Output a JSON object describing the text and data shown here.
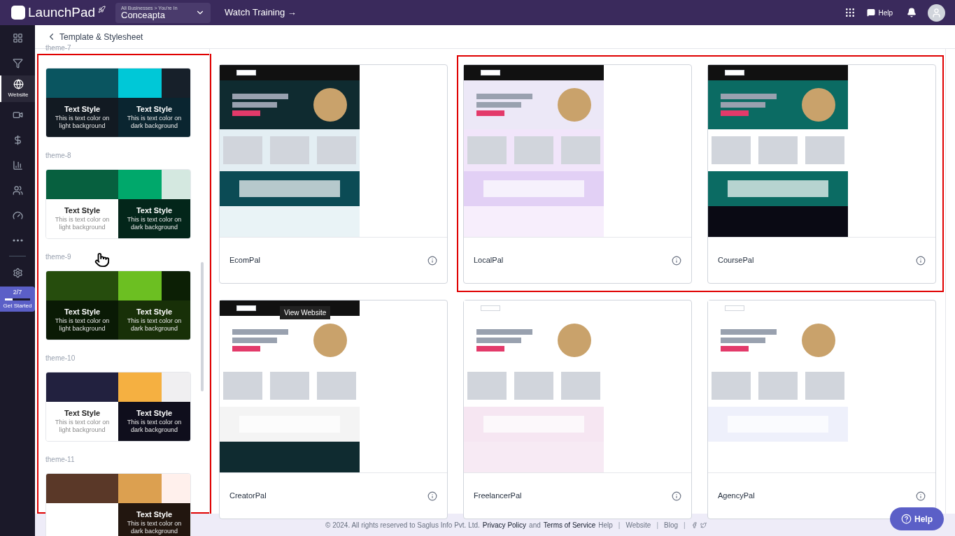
{
  "topbar": {
    "brand": "LaunchPad",
    "business": {
      "caption": "All Businesses > You're In",
      "value": "Conceapta"
    },
    "training": "Watch Training →",
    "help": "Help"
  },
  "sidebar": {
    "items": [
      {
        "selected": false
      },
      {
        "selected": false
      },
      {
        "selected": true,
        "label": "Website"
      },
      {
        "selected": false
      },
      {
        "selected": false
      },
      {
        "selected": false
      },
      {
        "selected": false
      },
      {
        "selected": false
      },
      {
        "selected": false
      }
    ],
    "progress": {
      "count": "2/7",
      "level": 0.3,
      "label": "Get Started"
    }
  },
  "page": {
    "title": "Template & Stylesheet"
  },
  "themes": [
    {
      "name": "theme-7",
      "swatches": [
        {
          "color": "#0a5560"
        },
        {
          "color": "#00c8d7"
        },
        {
          "color": "#17202a"
        }
      ],
      "light": {
        "color": "#121a22",
        "title": "Text Style",
        "text": "This is text color on light background"
      },
      "dark": {
        "color": "#0a2530",
        "title": "Text Style",
        "text": "This is text color on dark background"
      }
    },
    {
      "name": "theme-8",
      "swatches": [
        {
          "color": "#07603f"
        },
        {
          "color": "#00a86b"
        },
        {
          "color": "#d4e8e0"
        }
      ],
      "light": {
        "color": "#ffffff",
        "title": "Text Style",
        "text": "This is text color on light background"
      },
      "dark": {
        "color": "#03261a",
        "title": "Text Style",
        "text": "This is text color on dark background"
      }
    },
    {
      "name": "theme-9",
      "swatches": [
        {
          "color": "#264d0d"
        },
        {
          "color": "#6cbf22"
        },
        {
          "color": "#0c1f05"
        }
      ],
      "light": {
        "color": "#0a1a05",
        "title": "Text Style",
        "text": "This is text color on light background"
      },
      "dark": {
        "color": "#183008",
        "title": "Text Style",
        "text": "This is text color on dark background"
      }
    },
    {
      "name": "theme-10",
      "swatches": [
        {
          "color": "#22213f"
        },
        {
          "color": "#f5b041"
        },
        {
          "color": "#f0eff1"
        }
      ],
      "light": {
        "color": "#ffffff",
        "title": "Text Style",
        "text": "This is text color on light background"
      },
      "dark": {
        "color": "#0f0e1c",
        "title": "Text Style",
        "text": "This is text color on dark background"
      }
    },
    {
      "name": "theme-11",
      "swatches": [
        {
          "color": "#5a3828"
        },
        {
          "color": "#dca050"
        },
        {
          "color": "#fff0ec"
        }
      ],
      "light": {
        "color": "#ffffff"
      },
      "dark": {
        "color": "#22160f",
        "title": "Text Style",
        "text": "This is text color on dark background"
      }
    }
  ],
  "templates": [
    {
      "name": "EcomPal"
    },
    {
      "name": "LocalPal"
    },
    {
      "name": "CoursePal"
    },
    {
      "name": "CreatorPal",
      "tooltip": "View Website"
    },
    {
      "name": "FreelancerPal"
    },
    {
      "name": "AgencyPal"
    }
  ],
  "footer": {
    "copyright": "©  2024. All rights reserved to Saglus Info Pvt. Ltd.",
    "privacy": "Privacy Policy",
    "and": "and",
    "terms": "Terms of Service",
    "links": [
      {
        "kind": "link",
        "label": "Help"
      },
      {
        "kind": "separator",
        "label": "|"
      },
      {
        "kind": "link",
        "label": "Website"
      },
      {
        "kind": "separator",
        "label": "|"
      },
      {
        "kind": "link",
        "label": "Blog"
      },
      {
        "kind": "separator",
        "label": "|"
      }
    ],
    "help_button": "Help"
  }
}
